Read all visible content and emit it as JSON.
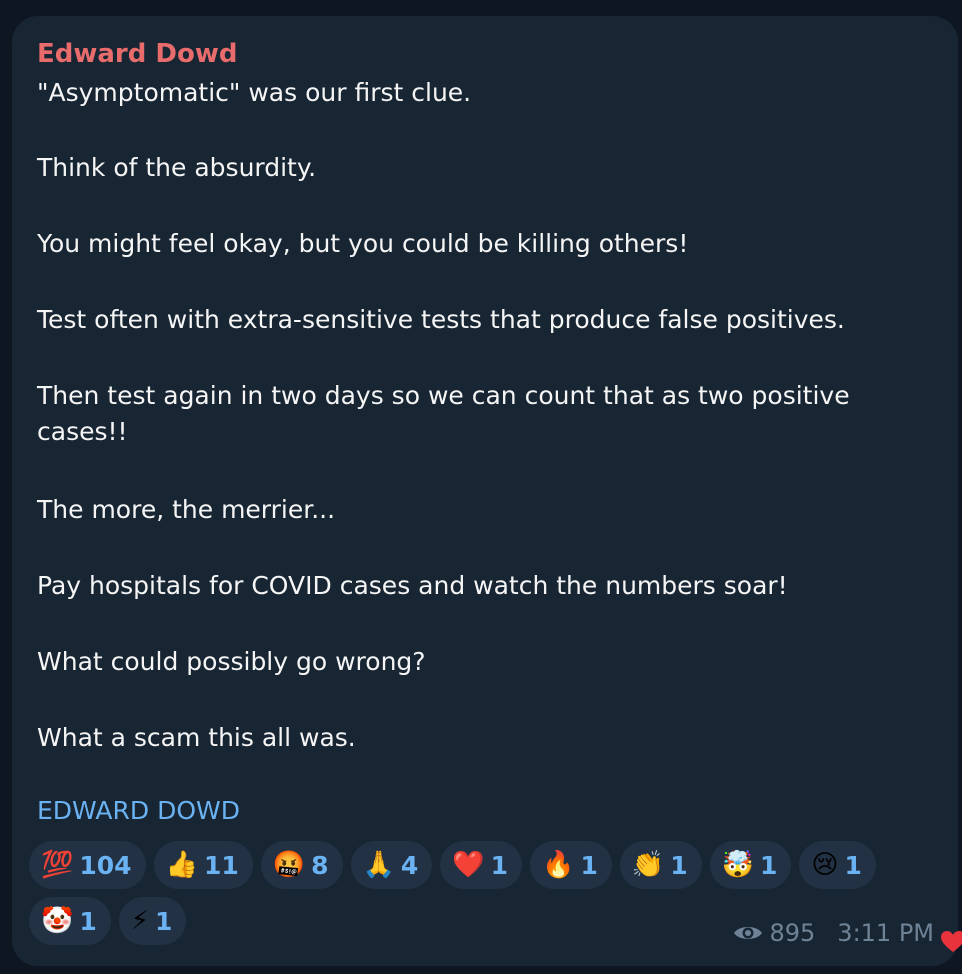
{
  "message": {
    "sender": "Edward Dowd",
    "paragraphs": [
      "\"Asymptomatic\" was our first clue.",
      "Think of the absurdity.",
      "You might feel okay, but you could be killing others!",
      "Test often with extra-sensitive tests that produce false positives.",
      "Then test again in two days so we can count that as two positive cases!!",
      "The more, the merrier...",
      "Pay hospitals for COVID cases and watch the numbers soar!",
      "What could possibly go wrong?",
      "What a scam this all was."
    ],
    "signature": "EDWARD DOWD",
    "views": "895",
    "time": "3:11 PM"
  },
  "reactions": [
    {
      "emoji": "💯",
      "count": "104",
      "icon": "hundred-points-icon"
    },
    {
      "emoji": "👍",
      "count": "11",
      "icon": "thumbs-up-icon"
    },
    {
      "emoji": "🤬",
      "count": "8",
      "icon": "cursing-face-icon"
    },
    {
      "emoji": "🙏",
      "count": "4",
      "icon": "praying-hands-icon"
    },
    {
      "emoji": "❤️",
      "count": "1",
      "icon": "red-heart-icon"
    },
    {
      "emoji": "🔥",
      "count": "1",
      "icon": "fire-icon"
    },
    {
      "emoji": "👏",
      "count": "1",
      "icon": "clapping-hands-icon"
    },
    {
      "emoji": "🤯",
      "count": "1",
      "icon": "exploding-head-icon"
    },
    {
      "emoji": "😢",
      "count": "1",
      "icon": "crying-face-icon"
    },
    {
      "emoji": "🤡",
      "count": "1",
      "icon": "clown-face-icon"
    },
    {
      "emoji": "⚡",
      "count": "1",
      "icon": "lightning-icon"
    }
  ],
  "colors": {
    "background": "#0e1621",
    "bubble": "#182533",
    "sender": "#e86c6c",
    "link": "#6ab2f2",
    "chip": "#223143",
    "meta": "#6f8396"
  }
}
